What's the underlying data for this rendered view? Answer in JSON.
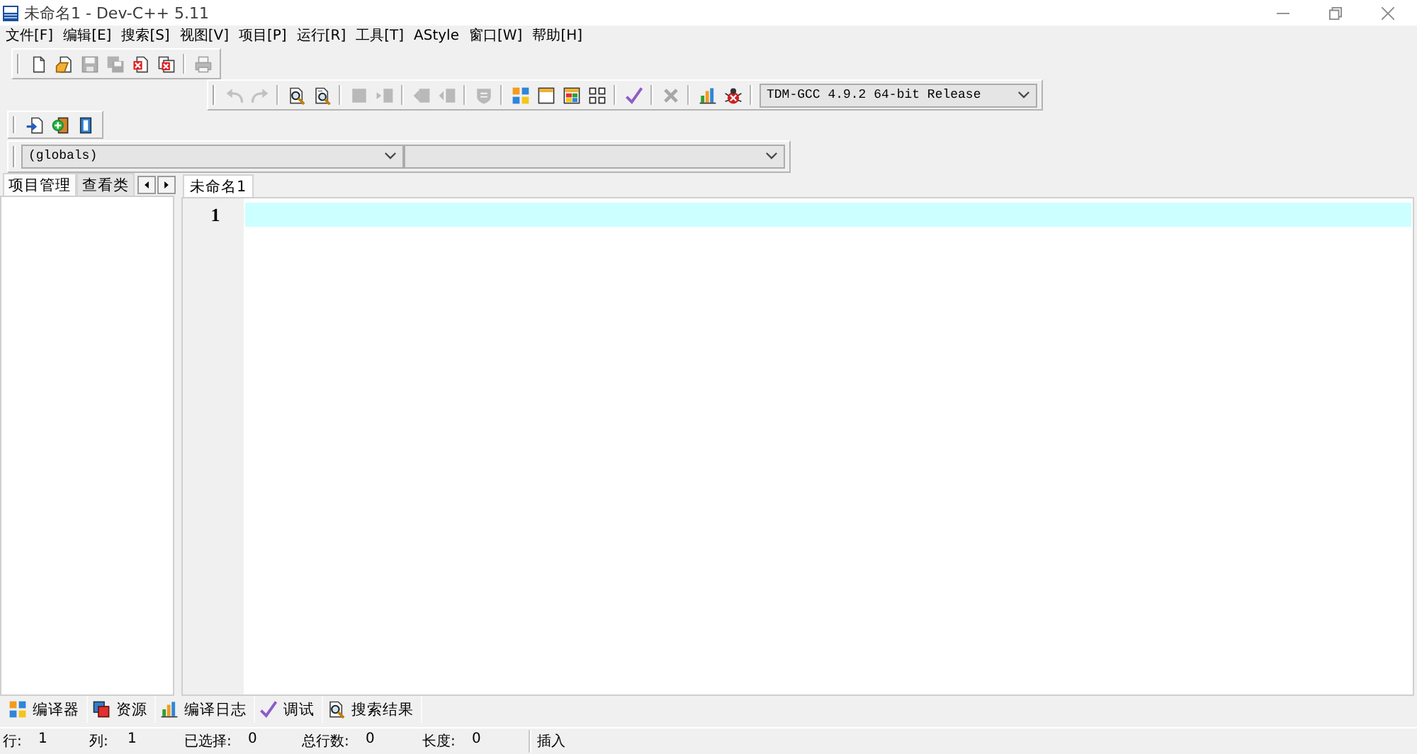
{
  "window": {
    "title": "未命名1 - Dev-C++ 5.11"
  },
  "menu": [
    "文件[F]",
    "编辑[E]",
    "搜索[S]",
    "视图[V]",
    "项目[P]",
    "运行[R]",
    "工具[T]",
    "AStyle",
    "窗口[W]",
    "帮助[H]"
  ],
  "toolbars": [
    {
      "groups": [
        [
          {
            "kind": "new",
            "disabled": false
          },
          {
            "kind": "open",
            "disabled": false
          },
          {
            "kind": "save",
            "disabled": true
          },
          {
            "kind": "saveall",
            "disabled": true
          },
          {
            "kind": "close",
            "disabled": false
          },
          {
            "kind": "closeall",
            "disabled": false
          }
        ],
        [
          {
            "kind": "print",
            "disabled": true
          }
        ]
      ]
    },
    {
      "groups": [
        [
          {
            "kind": "undo",
            "disabled": true
          },
          {
            "kind": "redo",
            "disabled": true
          }
        ],
        [
          {
            "kind": "find",
            "disabled": false
          },
          {
            "kind": "replace",
            "disabled": false
          }
        ],
        [
          {
            "kind": "indent",
            "disabled": true
          },
          {
            "kind": "unindent",
            "disabled": true
          }
        ],
        [
          {
            "kind": "bookmark",
            "disabled": true
          },
          {
            "kind": "goto",
            "disabled": true
          }
        ],
        [
          {
            "kind": "comment",
            "disabled": true
          }
        ],
        [
          {
            "kind": "compile",
            "disabled": false
          },
          {
            "kind": "run",
            "disabled": false
          },
          {
            "kind": "buildrun",
            "disabled": false
          },
          {
            "kind": "rebuild",
            "disabled": false
          }
        ],
        [
          {
            "kind": "check",
            "disabled": false
          }
        ],
        [
          {
            "kind": "stop",
            "disabled": true
          }
        ],
        [
          {
            "kind": "profile",
            "disabled": false
          },
          {
            "kind": "debug",
            "disabled": false
          }
        ]
      ],
      "compiler": "TDM-GCC 4.9.2 64-bit Release"
    },
    {
      "groups": [
        [
          {
            "kind": "insert",
            "disabled": false
          },
          {
            "kind": "toggle",
            "disabled": false
          },
          {
            "kind": "jump",
            "disabled": false
          }
        ]
      ]
    }
  ],
  "class_browser": {
    "scope": "(globals)"
  },
  "side_panel": {
    "tabs": [
      {
        "label": "项目管理",
        "selected": true
      },
      {
        "label": "查看类",
        "selected": false
      }
    ]
  },
  "editor": {
    "tabs": [
      {
        "label": "未命名1",
        "selected": true
      }
    ],
    "lines": [
      {
        "number": "1",
        "current": true
      }
    ]
  },
  "bottom_tabs": [
    {
      "label": "编译器",
      "kind": "compiler",
      "selected": false
    },
    {
      "label": "资源",
      "kind": "resources",
      "selected": false
    },
    {
      "label": "编译日志",
      "kind": "log",
      "selected": false
    },
    {
      "label": "调试",
      "kind": "debug",
      "selected": false
    },
    {
      "label": "搜索结果",
      "kind": "search",
      "selected": false
    }
  ],
  "status_bar": {
    "fields": [
      {
        "label": "行:",
        "value": "1"
      },
      {
        "label": "列:",
        "value": "1"
      },
      {
        "label": "已选择:",
        "value": "0"
      },
      {
        "label": "总行数:",
        "value": "0"
      },
      {
        "label": "长度:",
        "value": "0"
      }
    ],
    "mode": "插入"
  }
}
